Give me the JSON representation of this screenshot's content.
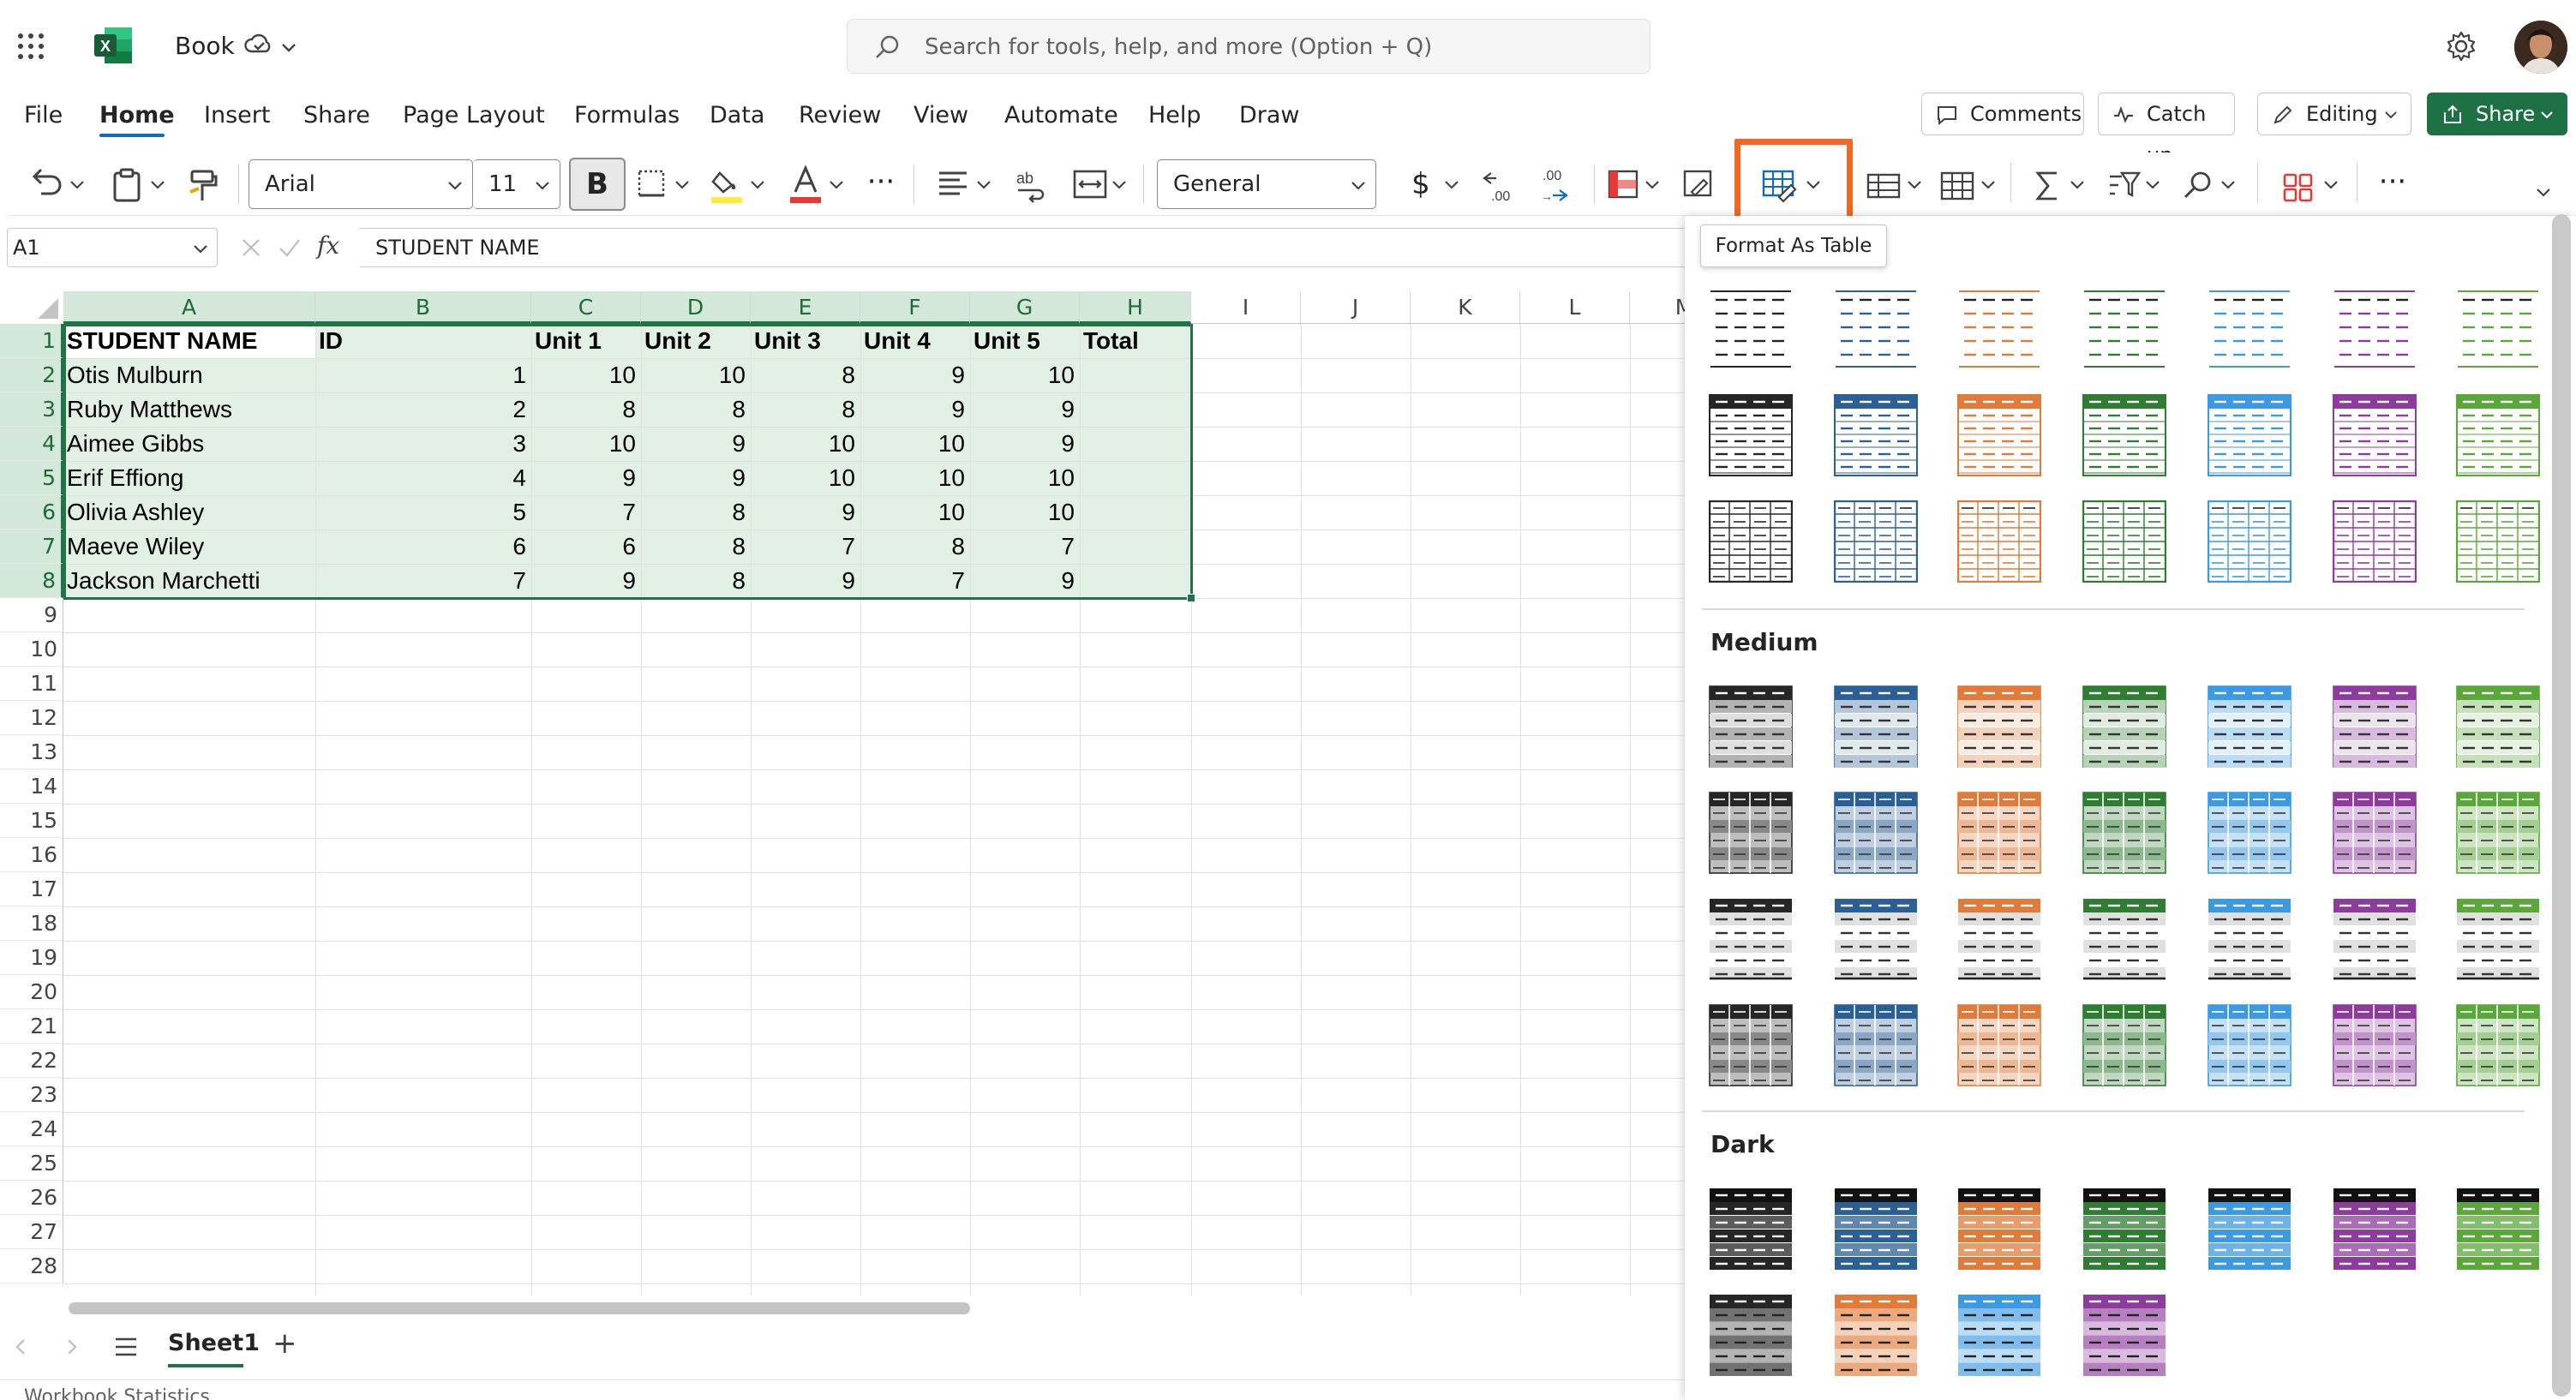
{
  "title_bar": {
    "app_icon": "excel-icon",
    "doc_title": "Book",
    "search_placeholder": "Search for tools, help, and more (Option + Q)"
  },
  "menu": {
    "tabs": [
      "File",
      "Home",
      "Insert",
      "Share",
      "Page Layout",
      "Formulas",
      "Data",
      "Review",
      "View",
      "Automate",
      "Help",
      "Draw"
    ],
    "active_tab": "Home",
    "comments_label": "Comments",
    "catchup_label": "Catch up",
    "editing_label": "Editing",
    "share_label": "Share"
  },
  "ribbon": {
    "font_name": "Arial",
    "font_size": "11",
    "bold_label": "B",
    "number_format": "General",
    "currency_symbol": "$",
    "more_label": "···"
  },
  "formula_bar": {
    "name_box": "A1",
    "fx_label": "fx",
    "formula": "STUDENT NAME"
  },
  "tooltip": "Format As Table",
  "grid": {
    "columns": [
      "A",
      "B",
      "C",
      "D",
      "E",
      "F",
      "G",
      "H",
      "I",
      "J",
      "K",
      "L",
      "M"
    ],
    "rows": [
      "1",
      "2",
      "3",
      "4",
      "5",
      "6",
      "7",
      "8",
      "9",
      "10",
      "11",
      "12",
      "13",
      "14",
      "15",
      "16",
      "17",
      "18",
      "19",
      "20",
      "21",
      "22",
      "23",
      "24",
      "25",
      "26",
      "27",
      "28"
    ],
    "header_row": [
      "STUDENT NAME",
      "ID",
      "Unit 1",
      "Unit 2",
      "Unit 3",
      "Unit 4",
      "Unit 5",
      "Total"
    ],
    "data_rows": [
      [
        "Otis Mulburn",
        "1",
        "10",
        "10",
        "8",
        "9",
        "10"
      ],
      [
        "Ruby Matthews",
        "2",
        "8",
        "8",
        "8",
        "9",
        "9"
      ],
      [
        "Aimee Gibbs",
        "3",
        "10",
        "9",
        "10",
        "10",
        "9"
      ],
      [
        "Erif Effiong",
        "4",
        "9",
        "9",
        "10",
        "10",
        "10"
      ],
      [
        "Olivia Ashley",
        "5",
        "7",
        "8",
        "9",
        "10",
        "10"
      ],
      [
        "Maeve Wiley",
        "6",
        "6",
        "8",
        "7",
        "8",
        "7"
      ],
      [
        "Jackson Marchetti",
        "7",
        "9",
        "8",
        "9",
        "7",
        "9"
      ]
    ]
  },
  "sheets": {
    "active": "Sheet1",
    "add_label": "+",
    "status": "Workbook Statistics"
  },
  "gallery": {
    "sections": [
      "Medium",
      "Dark"
    ],
    "theme_colors": {
      "black": "#262626",
      "blue": "#2a6096",
      "orange": "#e07b39",
      "green": "#2e7d32",
      "sky": "#3b9ae1",
      "purple": "#8e3b9e",
      "lime": "#5aa83a"
    }
  }
}
